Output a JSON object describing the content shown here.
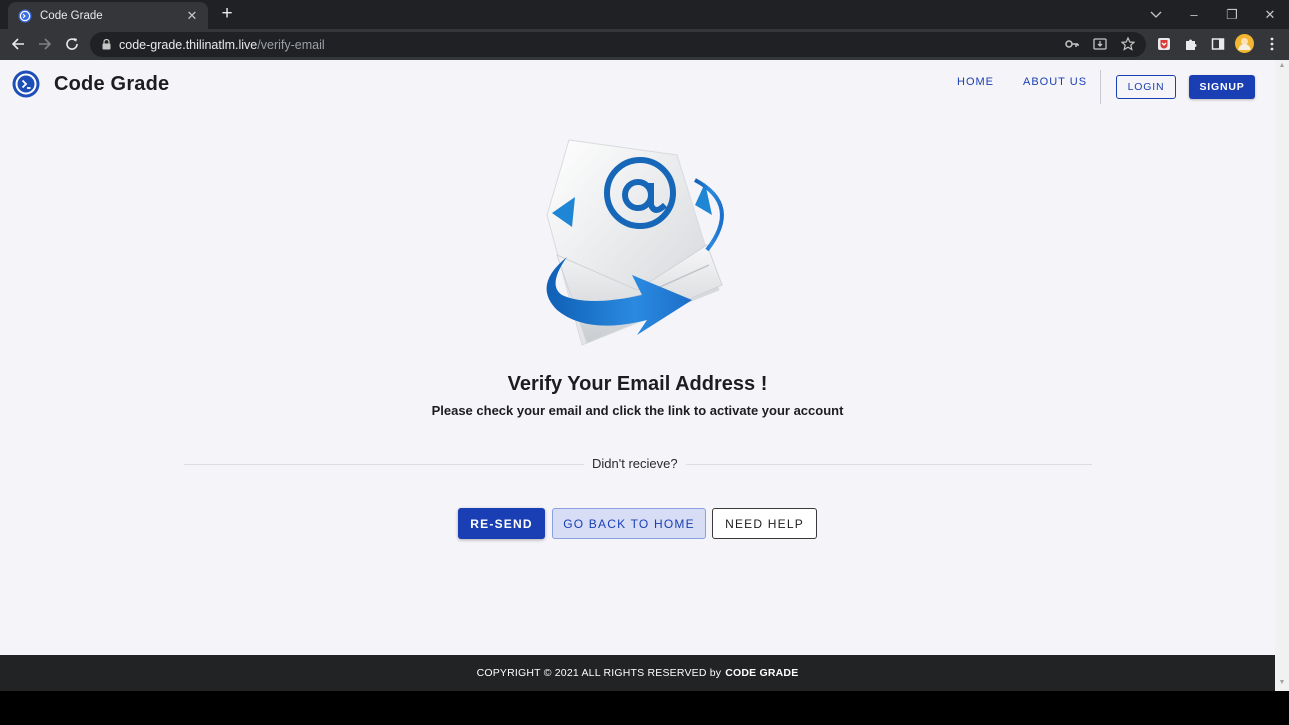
{
  "browser": {
    "tab_title": "Code Grade",
    "tab_close": "✕",
    "new_tab": "+",
    "url_host": "code-grade.thilinatlm.live",
    "url_path": "/verify-email",
    "window_controls": {
      "minimize": "–",
      "restore": "❐",
      "close": "✕"
    }
  },
  "header": {
    "brand": "Code Grade",
    "nav": {
      "home": "HOME",
      "about": "ABOUT US"
    },
    "login": "LOGIN",
    "signup": "SIGNUP"
  },
  "main": {
    "title": "Verify Your Email Address !",
    "subtitle": "Please check your email and click the link to activate your account",
    "divider_text": "Didn't recieve?",
    "buttons": {
      "resend": "RE-SEND",
      "go_home": "GO BACK TO HOME",
      "need_help": "NEED HELP"
    }
  },
  "footer": {
    "copyright": "COPYRIGHT © 2021 ALL RIGHTS RESERVED by",
    "brand": "CODE GRADE"
  },
  "colors": {
    "primary": "#1a3fb4",
    "page_bg": "#f5f4f8",
    "footer_bg": "#222325",
    "chrome_dark": "#202124",
    "chrome_mid": "#35363a"
  },
  "icons": {
    "tab_favicon": "code-grade-favicon-icon",
    "back": "back-arrow-icon",
    "forward": "forward-arrow-icon",
    "reload": "reload-icon",
    "lock": "lock-icon",
    "key": "key-icon",
    "install": "install-app-icon",
    "bookmark": "star-icon",
    "extension": "puzzle-icon",
    "sidebar": "side-panel-icon",
    "profile": "avatar",
    "menu": "kebab-menu-icon",
    "hero": "email-envelope-icon"
  }
}
